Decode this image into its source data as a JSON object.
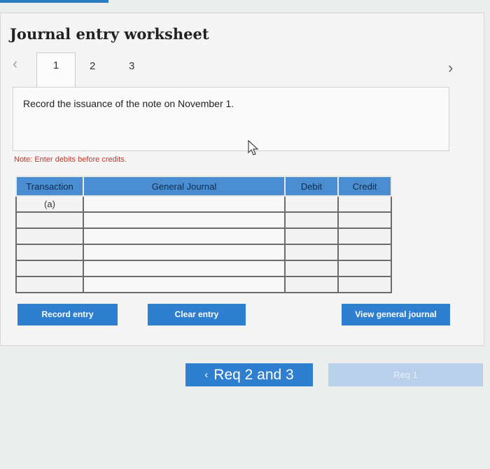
{
  "title": "Journal entry worksheet",
  "tabs": {
    "prev": "‹",
    "items": [
      "1",
      "2",
      "3"
    ],
    "next": "›"
  },
  "instruction": "Record the issuance of the note on November 1.",
  "note": "Note: Enter debits before credits.",
  "table": {
    "headers": [
      "Transaction",
      "General Journal",
      "Debit",
      "Credit"
    ],
    "rows": [
      {
        "transaction": "(a)"
      },
      {
        "transaction": ""
      },
      {
        "transaction": ""
      },
      {
        "transaction": ""
      },
      {
        "transaction": ""
      },
      {
        "transaction": ""
      }
    ]
  },
  "buttons": {
    "record": "Record entry",
    "clear": "Clear entry",
    "view": "View general journal"
  },
  "nav": {
    "req_label": "Req 2 and 3",
    "req_arrow": "‹",
    "next_label": "Req 1"
  },
  "colors": {
    "accent": "#2f7fd0",
    "header": "#4a8ed1",
    "note": "#c0392b"
  }
}
